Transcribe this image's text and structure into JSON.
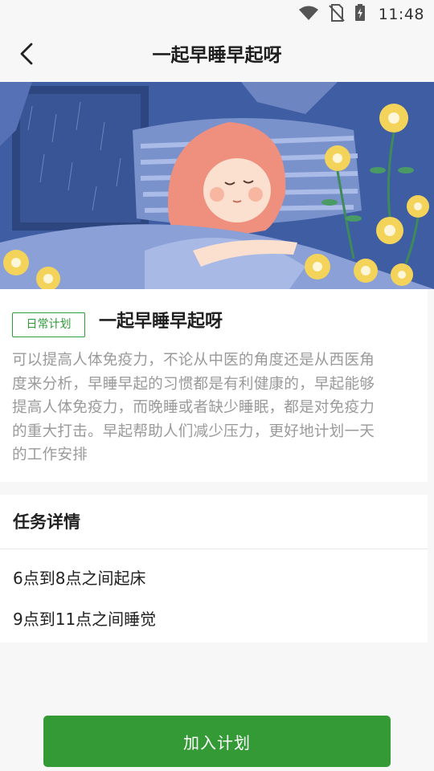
{
  "status_bar": {
    "time": "11:48",
    "icons": [
      "wifi-icon",
      "no-sim-icon",
      "battery-charging-icon"
    ]
  },
  "header": {
    "title": "一起早睡早起呀",
    "back_icon": "chevron-left-icon"
  },
  "banner": {
    "description_icons": [
      "sleeping-girl-illustration"
    ]
  },
  "intro": {
    "tag": "日常计划",
    "title": "一起早睡早起呀",
    "description_lines": [
      "可以提高人体免疫力，不论从中医的角度还是从西医角",
      "度来分析，早睡早起的习惯都是有利健康的，早起能够",
      "提高人体免疫力，而晚睡或者缺少睡眠，都是对免疫力",
      "的重大打击。早起帮助人们减少压力，更好地计划一天",
      "的工作安排"
    ]
  },
  "detail": {
    "title": "任务详情",
    "items": [
      "6点到8点之间起床",
      "9点到11点之间睡觉"
    ]
  },
  "footer": {
    "button_label": "加入计划"
  },
  "colors": {
    "accent": "#339a35",
    "tag_green": "#2f9b3a",
    "background": "#f7f7f7"
  }
}
